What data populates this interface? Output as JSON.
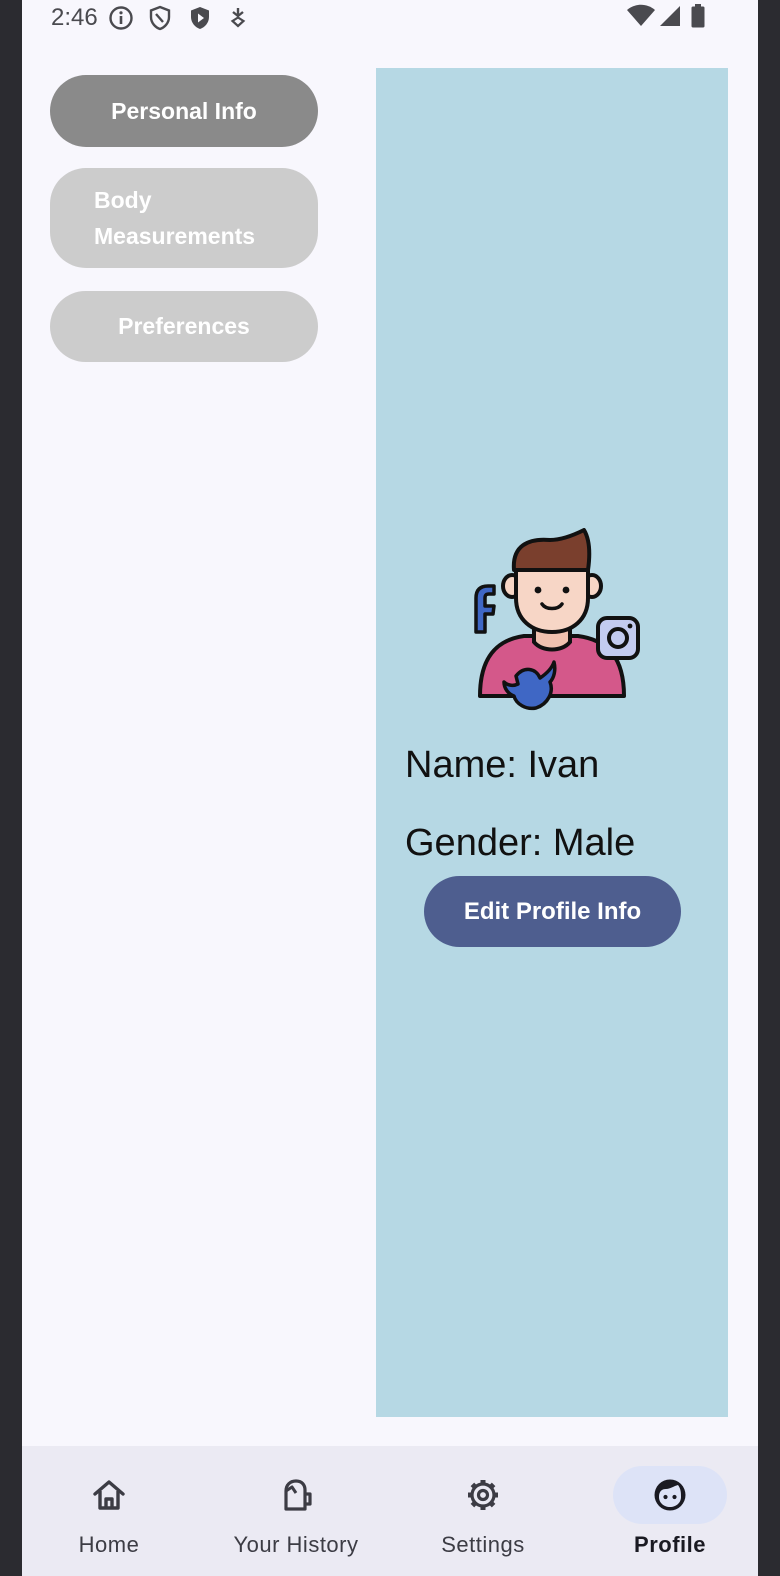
{
  "status_bar": {
    "time": "2:46",
    "left_icons": [
      "info-icon",
      "shield-icon",
      "play-shield-icon",
      "download-icon"
    ],
    "right_icons": [
      "wifi-icon",
      "signal-icon",
      "battery-icon"
    ]
  },
  "tabs": [
    {
      "label": "Personal Info",
      "selected": true
    },
    {
      "label": "Body Measurements",
      "selected": false
    },
    {
      "label": "Preferences",
      "selected": false
    }
  ],
  "profile": {
    "avatar_icon": "user-social-avatar-icon",
    "name_line": "Name: Ivan",
    "gender_line": "Gender: Male",
    "edit_button": "Edit Profile Info"
  },
  "bottom_nav": [
    {
      "label": "Home",
      "icon": "home-icon",
      "active": false
    },
    {
      "label": "Your History",
      "icon": "history-icon",
      "active": false
    },
    {
      "label": "Settings",
      "icon": "gear-icon",
      "active": false
    },
    {
      "label": "Profile",
      "icon": "face-icon",
      "active": true
    }
  ],
  "colors": {
    "tab_selected": "#8a8a8a",
    "tab_unselected": "#cccccc",
    "panel_background": "#b6d8e4",
    "edit_button": "#4e5e8f",
    "nav_background": "#ebeaf3",
    "nav_active_pill": "#dde3f7"
  }
}
